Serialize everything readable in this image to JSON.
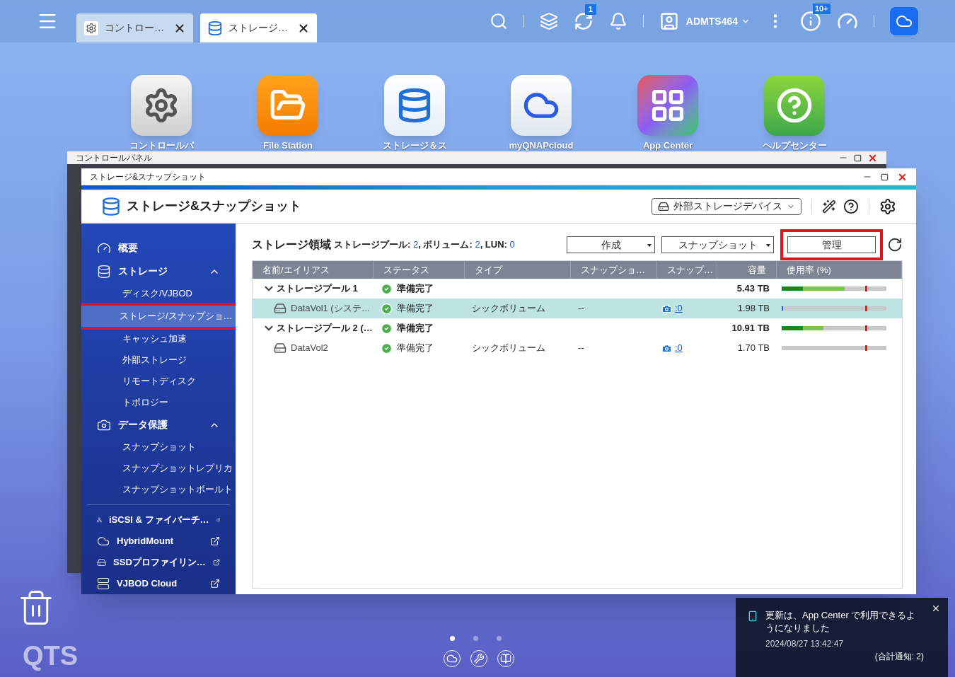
{
  "taskbar": {
    "tabs": [
      {
        "label": "コントロー…",
        "selected": false
      },
      {
        "label": "ストレージ…",
        "selected": true
      }
    ],
    "sync_badge": "1",
    "user": "ADMTS464",
    "info_badge": "10+"
  },
  "desktop_icons": [
    {
      "label": "コントロールパ",
      "kind": "settings"
    },
    {
      "label": "File Station",
      "kind": "folder"
    },
    {
      "label": "ストレージ＆ス",
      "kind": "storage"
    },
    {
      "label": "myQNAPcloud",
      "kind": "cloud"
    },
    {
      "label": "App Center",
      "kind": "apps"
    },
    {
      "label": "ヘルプセンター",
      "kind": "help"
    }
  ],
  "back_window": {
    "title": "コントロールパネル"
  },
  "window": {
    "title": "ストレージ&スナップショット",
    "app_title": "ストレージ&スナップショット",
    "device_menu": "外部ストレージデバイス"
  },
  "sidebar": {
    "items": [
      {
        "kind": "group",
        "label": "概要"
      },
      {
        "kind": "group",
        "label": "ストレージ",
        "expanded": true,
        "children": [
          {
            "label": "ディスク/VJBOD",
            "selected": false,
            "annotated": false
          },
          {
            "label": "ストレージ/スナップショ…",
            "selected": true,
            "annotated": true
          },
          {
            "label": "キャッシュ加速",
            "selected": false,
            "annotated": false
          },
          {
            "label": "外部ストレージ",
            "selected": false,
            "annotated": false
          },
          {
            "label": "リモートディスク",
            "selected": false,
            "annotated": false
          },
          {
            "label": "トポロジー",
            "selected": false,
            "annotated": false
          }
        ]
      },
      {
        "kind": "group",
        "label": "データ保護",
        "expanded": true,
        "children": [
          {
            "label": "スナップショット",
            "selected": false,
            "annotated": false
          },
          {
            "label": "スナップショットレプリカ",
            "selected": false,
            "annotated": false
          },
          {
            "label": "スナップショットボールト",
            "selected": false,
            "annotated": false
          }
        ]
      },
      {
        "kind": "divider"
      },
      {
        "kind": "external",
        "label": "iSCSI & ファイバーチ…"
      },
      {
        "kind": "external",
        "label": "HybridMount"
      },
      {
        "kind": "external",
        "label": "SSDプロファイリン…"
      },
      {
        "kind": "external",
        "label": "VJBOD Cloud"
      }
    ]
  },
  "content": {
    "title": "ストレージ領域",
    "summary": [
      {
        "label": "ストレージプール:",
        "value": "2"
      },
      {
        "label": ", ボリューム:",
        "value": "2"
      },
      {
        "label": ", LUN:",
        "value": "0"
      }
    ],
    "buttons": [
      {
        "label": "作成",
        "dropdown": true,
        "annotated": false
      },
      {
        "label": "スナップショット",
        "dropdown": true,
        "annotated": false
      },
      {
        "label": "管理",
        "dropdown": false,
        "annotated": true
      }
    ],
    "table": {
      "columns": [
        "名前/エイリアス",
        "ステータス",
        "タイプ",
        "スナップショ…",
        "スナップ…",
        "容量",
        "使用率 (%)"
      ],
      "rows": [
        {
          "kind": "pool",
          "name": "ストレージプール 1",
          "expanded": true,
          "status": "準備完了",
          "capacity": "5.43 TB",
          "selected": false,
          "usage": [
            {
              "kind": "data",
              "level": 0.2
            },
            {
              "kind": "snapshot",
              "level": 0.4
            }
          ],
          "threshold": {
            "level": 0.8
          }
        },
        {
          "kind": "volume",
          "name": "DataVol1 (システ…",
          "status": "準備完了",
          "type": "シックボリューム",
          "snap_col": "--",
          "snap_count": ":0",
          "capacity": "1.98 TB",
          "selected": true,
          "usage": [
            {
              "kind": "volume",
              "level": 0.01
            }
          ],
          "threshold": {
            "level": 0.8
          }
        },
        {
          "kind": "pool",
          "name": "ストレージプール 2 (…",
          "expanded": true,
          "status": "準備完了",
          "capacity": "10.91 TB",
          "selected": false,
          "usage": [
            {
              "kind": "data",
              "level": 0.2
            },
            {
              "kind": "snapshot",
              "level": 0.2
            }
          ],
          "threshold": {
            "level": 0.8
          }
        },
        {
          "kind": "volume",
          "name": "DataVol2",
          "status": "準備完了",
          "type": "シックボリューム",
          "snap_col": "--",
          "snap_count": ":0",
          "capacity": "1.70 TB",
          "selected": false,
          "usage": [],
          "threshold": {
            "level": 0.8
          }
        }
      ]
    }
  },
  "pager": [
    {
      "selected": true
    },
    {
      "selected": false
    },
    {
      "selected": false
    }
  ],
  "brand": "QTS",
  "notification": {
    "message": "更新は、App Center で利用できるようになりました",
    "time": "2024/08/27 13:42:47",
    "total": "(合計通知: 2)"
  }
}
